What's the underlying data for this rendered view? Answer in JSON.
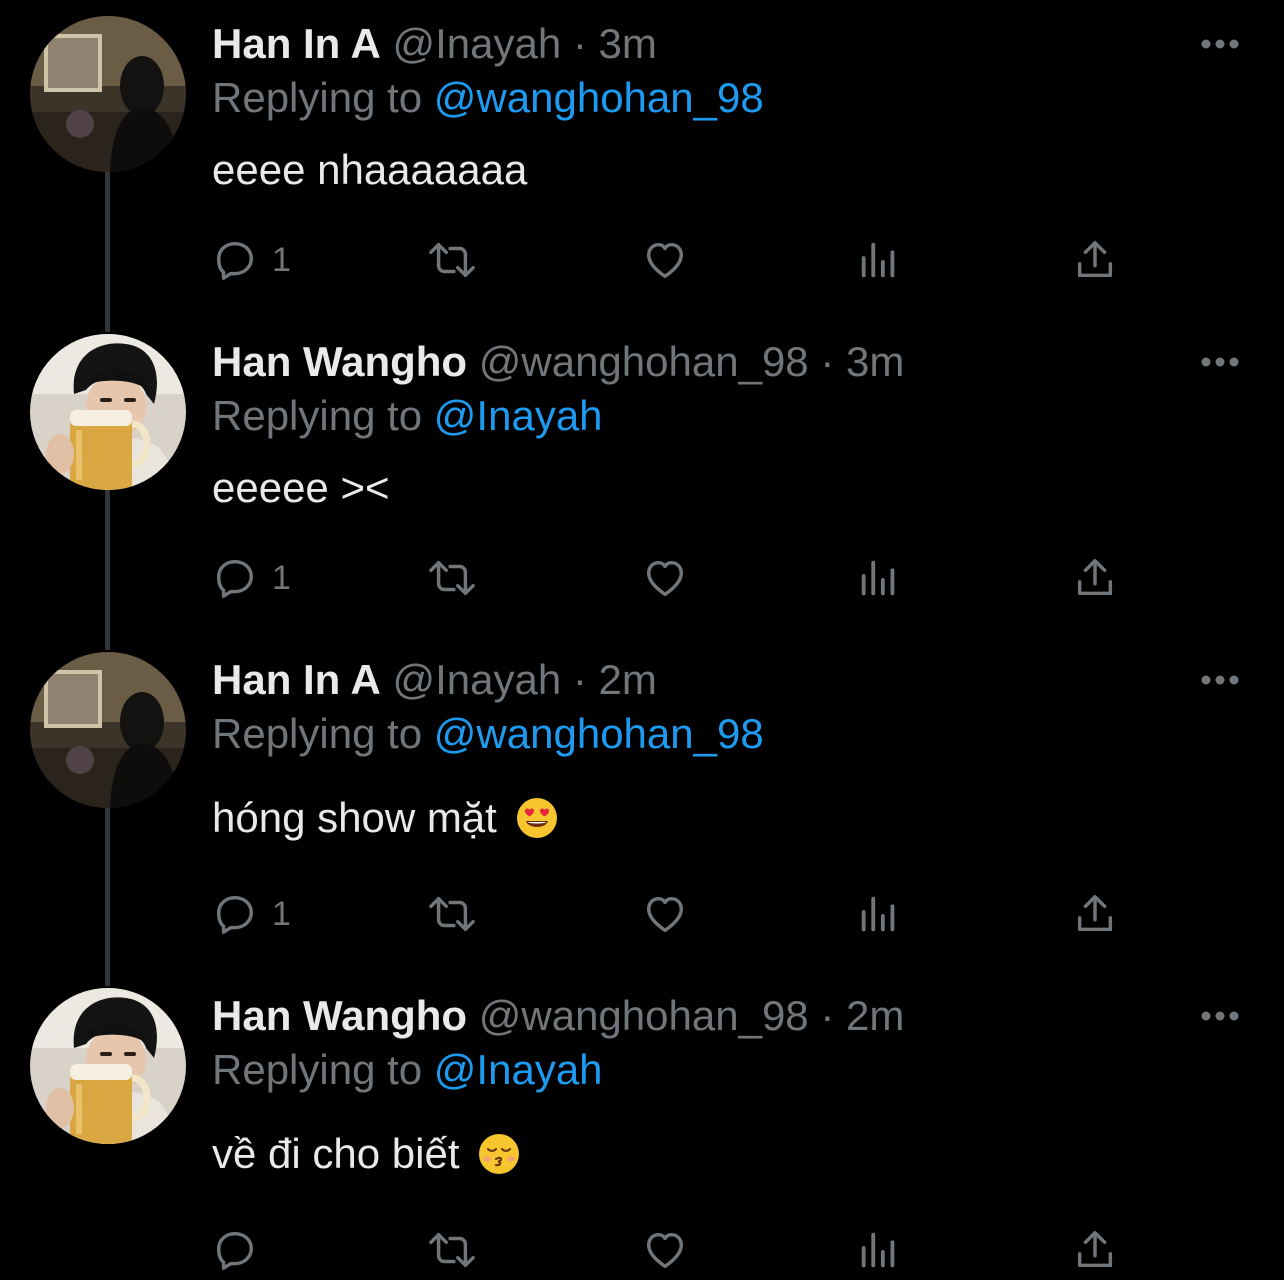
{
  "thread": [
    {
      "author": {
        "name": "Han In A",
        "handle": "@Inayah",
        "avatar": "avatar-photo-girl"
      },
      "separator": "·",
      "time": "3m",
      "replying_label": "Replying to",
      "replying_to": "@wanghohan_98",
      "text": "eeee nhaaaaaaa",
      "emoji": "",
      "counts": {
        "reply": "1"
      }
    },
    {
      "author": {
        "name": "Han Wangho",
        "handle": "@wanghohan_98",
        "avatar": "avatar-photo-boy-beer"
      },
      "separator": "·",
      "time": "3m",
      "replying_label": "Replying to",
      "replying_to": "@Inayah",
      "text": "eeeee ><",
      "emoji": "",
      "counts": {
        "reply": "1"
      }
    },
    {
      "author": {
        "name": "Han In A",
        "handle": "@Inayah",
        "avatar": "avatar-photo-girl"
      },
      "separator": "·",
      "time": "2m",
      "replying_label": "Replying to",
      "replying_to": "@wanghohan_98",
      "text": "hóng show mặt",
      "emoji": "heart-eyes-emoji",
      "counts": {
        "reply": "1"
      }
    },
    {
      "author": {
        "name": "Han Wangho",
        "handle": "@wanghohan_98",
        "avatar": "avatar-photo-boy-beer"
      },
      "separator": "·",
      "time": "2m",
      "replying_label": "Replying to",
      "replying_to": "@Inayah",
      "text": "về đi cho biết",
      "emoji": "kissing-closed-eyes-emoji",
      "counts": {
        "reply": ""
      }
    }
  ],
  "icons": {
    "more": "more-horizontal-icon",
    "reply": "reply-icon",
    "retweet": "retweet-icon",
    "like": "heart-icon",
    "views": "views-chart-icon",
    "share": "share-icon"
  },
  "colors": {
    "background": "#000000",
    "primary_text": "#e7e9ea",
    "secondary_text": "#71767b",
    "link": "#1d9bf0",
    "thread_line": "#333639"
  }
}
